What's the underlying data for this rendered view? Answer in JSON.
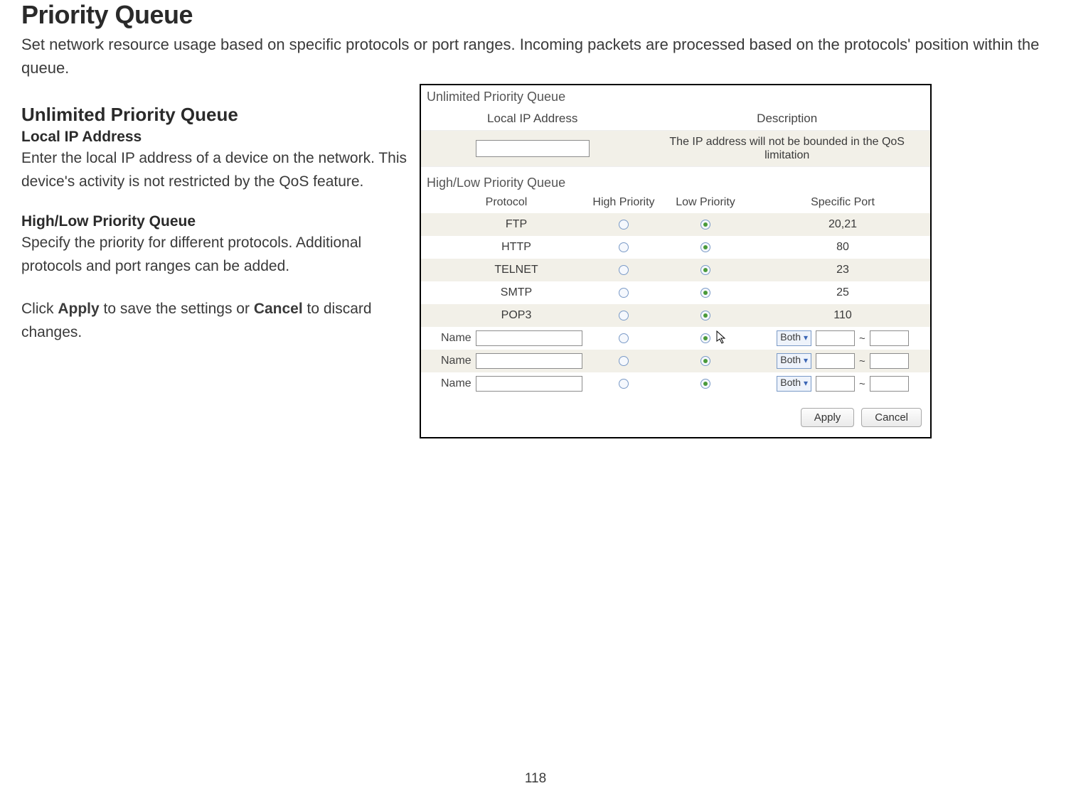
{
  "doc": {
    "title": "Priority Queue",
    "intro": "Set network resource usage based on specific protocols or port ranges. Incoming packets are processed based on the protocols' position within the queue.",
    "section1_title": "Unlimited Priority Queue",
    "section1_field": "Local IP Address",
    "section1_body": "Enter the local IP address of a device on the network. This device's activity is not restricted by the QoS feature.",
    "section2_title": "High/Low Priority Queue",
    "section2_body": "Specify the priority for different protocols. Additional protocols and port ranges can be added.",
    "apply_pre": "Click ",
    "apply_b1": "Apply",
    "apply_mid": " to save the settings or ",
    "apply_b2": "Cancel",
    "apply_post": " to discard changes.",
    "page_number": "118"
  },
  "panel": {
    "unlimited_title": "Unlimited Priority Queue",
    "unlimited_headers": {
      "local_ip": "Local IP Address",
      "description": "Description"
    },
    "unlimited_desc": "The IP address will not be bounded in the QoS limitation",
    "hl_title": "High/Low Priority Queue",
    "hl_headers": {
      "protocol": "Protocol",
      "high": "High Priority",
      "low": "Low Priority",
      "port": "Specific Port"
    },
    "rows": [
      {
        "protocol": "FTP",
        "high": false,
        "low": true,
        "port": "20,21"
      },
      {
        "protocol": "HTTP",
        "high": false,
        "low": true,
        "port": "80"
      },
      {
        "protocol": "TELNET",
        "high": false,
        "low": true,
        "port": "23"
      },
      {
        "protocol": "SMTP",
        "high": false,
        "low": true,
        "port": "25"
      },
      {
        "protocol": "POP3",
        "high": false,
        "low": true,
        "port": "110"
      }
    ],
    "custom_label": "Name",
    "custom_select": "Both",
    "tilde": "~",
    "buttons": {
      "apply": "Apply",
      "cancel": "Cancel"
    }
  }
}
